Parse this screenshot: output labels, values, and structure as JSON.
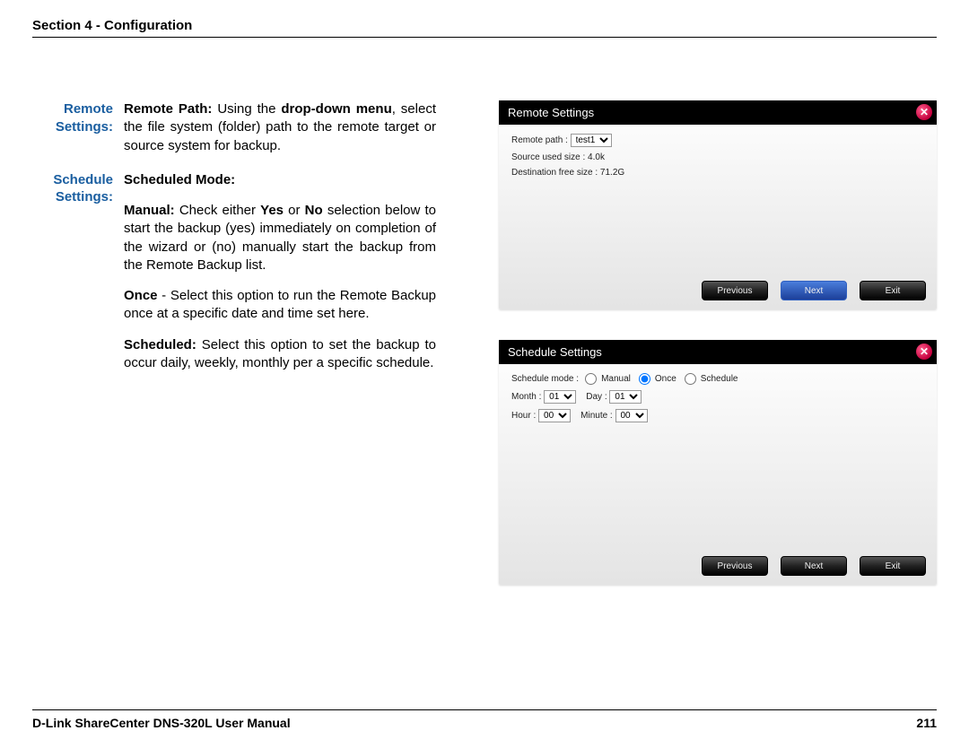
{
  "header": "Section 4 - Configuration",
  "definitions": {
    "remote": {
      "label1": "Remote",
      "label2": "Settings:",
      "para1_bold1": "Remote Path:",
      "para1_text1": " Using the ",
      "para1_bold2": "drop-down menu",
      "para1_text2": ", select the file system (folder) path to the remote target or source system for backup."
    },
    "schedule": {
      "label1": "Schedule",
      "label2": "Settings:",
      "p1_b1": "Scheduled Mode:",
      "p2_b1": "Manual:",
      "p2_t1": " Check either ",
      "p2_b2": "Yes",
      "p2_t2": " or ",
      "p2_b3": "No",
      "p2_t3": " selection below to start the backup (yes) immediately on completion of the wizard or (no) manually start the backup from the Remote Backup list.",
      "p3_b1": "Once",
      "p3_t1": " - Select this option to run the Remote Backup once at a specific date and time set here.",
      "p4_b1": "Scheduled:",
      "p4_t1": " Select this option to set the backup to occur daily, weekly, monthly per a specific schedule."
    }
  },
  "panel1": {
    "title": "Remote Settings",
    "remote_path_label": "Remote path :",
    "remote_path_value": "test1",
    "source_line": "Source used size : 4.0k",
    "dest_line": "Destination free size : 71.2G",
    "buttons": {
      "prev": "Previous",
      "next": "Next",
      "exit": "Exit"
    },
    "close": "✕"
  },
  "panel2": {
    "title": "Schedule Settings",
    "mode_label": "Schedule mode :",
    "opt_manual": "Manual",
    "opt_once": "Once",
    "opt_schedule": "Schedule",
    "month_label": "Month :",
    "month_value": "01",
    "day_label": "Day :",
    "day_value": "01",
    "hour_label": "Hour :",
    "hour_value": "00",
    "minute_label": "Minute :",
    "minute_value": "00",
    "buttons": {
      "prev": "Previous",
      "next": "Next",
      "exit": "Exit"
    },
    "close": "✕"
  },
  "footer": {
    "left": "D-Link ShareCenter DNS-320L User Manual",
    "right": "211"
  }
}
